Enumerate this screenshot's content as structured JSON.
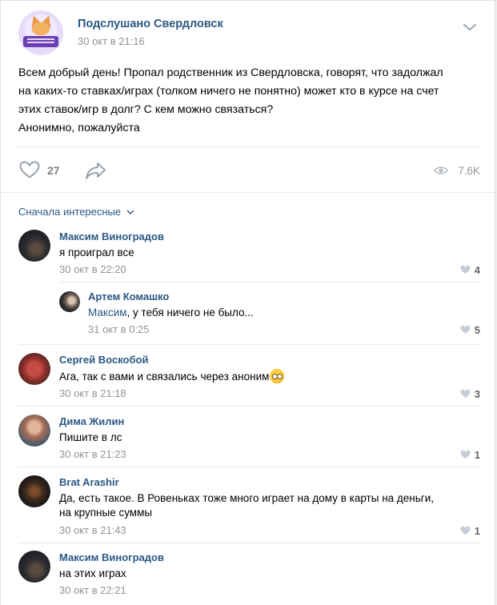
{
  "post": {
    "group_name": "Подслушано Свердловск",
    "date": "30 окт в 21:16",
    "text_lines": [
      "Всем добрый день! Пропал родственник из Свердловска, говорят, что задолжал",
      "на каких-то ставках/играх (толком ничего не понятно) может кто в курсе на счет",
      "этих ставок/игр в долг? С кем можно связаться?",
      "Анонимно, пожалуйста"
    ],
    "likes": "27",
    "views": "7.6K",
    "icons": {
      "like": "heart-icon",
      "share": "share-arrow-icon",
      "views": "eye-icon",
      "menu": "chevron-down-icon"
    }
  },
  "comments_sort": {
    "label": "Сначала интересные"
  },
  "comments": [
    {
      "author": "Максим Виноградов",
      "text_lines": [
        "я проиграл все"
      ],
      "date": "30 окт в 22:20",
      "likes": "4"
    },
    {
      "author": "Сергей Воскобой",
      "text_lines": [
        "Ага, так с вами и связались через аноним"
      ],
      "emoji": "face-with-rolling-eyes",
      "date": "30 окт в 21:18",
      "likes": "3"
    },
    {
      "author": "Дима Жилин",
      "text_lines": [
        "Пишите в лс"
      ],
      "date": "30 окт в 21:23",
      "likes": "1"
    },
    {
      "author": "Brat Arashir",
      "text_lines": [
        "Да, есть такое. В Ровеньках тоже много играет на дому в карты на деньги,",
        "на крупные суммы"
      ],
      "date": "30 окт в 21:43",
      "likes": "1"
    },
    {
      "author": "Максим Виноградов",
      "text_lines": [
        "на этих играх"
      ],
      "date": "30 окт в 22:21",
      "likes": ""
    }
  ],
  "reply": {
    "author": "Артем Комашко",
    "mention": "Максим",
    "text": ", у тебя ничего не было...",
    "date": "31 окт в 0:25",
    "likes": "5"
  },
  "colors": {
    "link": "#2a5885",
    "meta": "#939393",
    "background": "#edeef0"
  }
}
